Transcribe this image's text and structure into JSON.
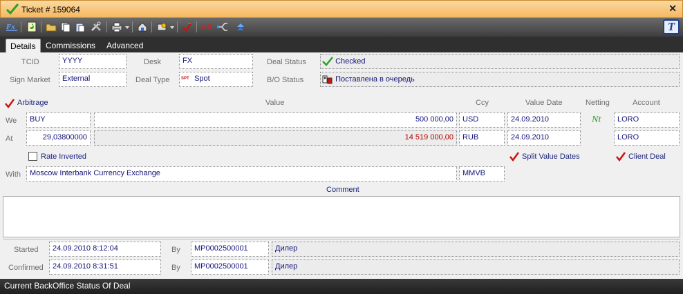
{
  "window": {
    "title": "Ticket # 159064",
    "close": "✕"
  },
  "tabs": [
    {
      "label": "Details"
    },
    {
      "label": "Commissions"
    },
    {
      "label": "Advanced"
    }
  ],
  "header": {
    "tcid_label": "TCID",
    "tcid_value": "YYYY",
    "desk_label": "Desk",
    "desk_value": "FX",
    "deal_status_label": "Deal Status",
    "deal_status_value": "Checked",
    "sign_market_label": "Sign Market",
    "sign_market_value": "External",
    "deal_type_label": "Deal Type",
    "deal_type_value": "Spot",
    "deal_type_badge": "SPT",
    "bo_status_label": "B/O Status",
    "bo_status_value": "Поставлена в очередь"
  },
  "deal": {
    "arbitrage_label": "Arbitrage",
    "col_value": "Value",
    "col_ccy": "Ccy",
    "col_value_date": "Value Date",
    "col_netting": "Netting",
    "col_account": "Account",
    "we_label": "We",
    "we_side": "BUY",
    "we_value": "500 000,00",
    "we_ccy": "USD",
    "we_date": "24.09.2010",
    "netting": "Nt",
    "we_account": "LORO",
    "at_label": "At",
    "at_rate": "29,03800000",
    "at_value": "14 519 000,00",
    "at_ccy": "RUB",
    "at_date": "24.09.2010",
    "at_account": "LORO",
    "rate_inverted_label": "Rate Inverted",
    "split_value_dates_label": "Split Value Dates",
    "client_deal_label": "Client Deal",
    "with_label": "With",
    "with_value": "Moscow Interbank Currency Exchange",
    "with_code": "MMVB",
    "comment_label": "Comment"
  },
  "audit": {
    "started_label": "Started",
    "started_time": "24.09.2010 8:12:04",
    "started_by_label": "By",
    "started_by_id": "MP0002500001",
    "started_by_role": "Дилер",
    "confirmed_label": "Confirmed",
    "confirmed_time": "24.09.2010 8:31:51",
    "confirmed_by_label": "By",
    "confirmed_by_id": "MP0002500001",
    "confirmed_by_role": "Дилер"
  },
  "status_bar": {
    "text": "Current BackOffice Status Of Deal"
  },
  "toolbar_icons": [
    "fx-icon",
    "refresh-icon",
    "open-folder-icon",
    "copy-icon",
    "paste-icon",
    "tools-icon",
    "print-icon",
    "home-icon",
    "settings-icon",
    "check-icon",
    "ab-icon",
    "split-icon",
    "arrows-icon"
  ],
  "colors": {
    "title_bar": "#f6b860",
    "toolbar": "#4a4a4a",
    "value_text": "#14147a",
    "negative_value": "#b00000",
    "check": "#2aa02a",
    "red_check": "#cc1111"
  }
}
